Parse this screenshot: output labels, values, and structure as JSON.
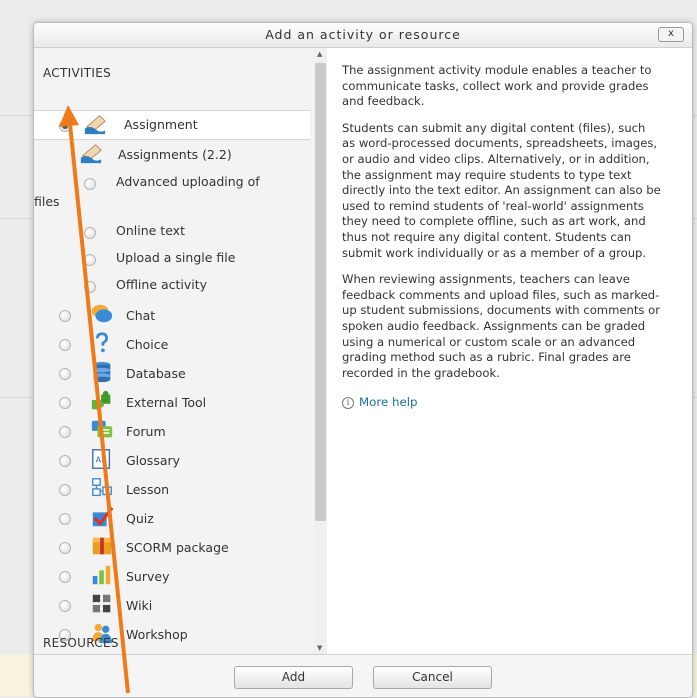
{
  "dialog": {
    "title": "Add an activity or resource",
    "close_label": "x"
  },
  "left": {
    "activities_heading": "ACTIVITIES",
    "resources_heading": "RESOURCES",
    "items": [
      {
        "label": "Assignment",
        "icon": "assignment-icon",
        "selected": true
      },
      {
        "label": "Assignments (2.2)",
        "icon": "assignment-icon"
      },
      {
        "label": "Advanced uploading of",
        "label2": "files"
      },
      {
        "label": "Online text"
      },
      {
        "label": "Upload a single file"
      },
      {
        "label": "Offline activity"
      },
      {
        "label": "Chat",
        "icon": "chat-icon"
      },
      {
        "label": "Choice",
        "icon": "question-icon"
      },
      {
        "label": "Database",
        "icon": "database-icon"
      },
      {
        "label": "External Tool",
        "icon": "puzzle-icon"
      },
      {
        "label": "Forum",
        "icon": "forum-icon"
      },
      {
        "label": "Glossary",
        "icon": "glossary-icon"
      },
      {
        "label": "Lesson",
        "icon": "lesson-icon"
      },
      {
        "label": "Quiz",
        "icon": "checkmark-icon"
      },
      {
        "label": "SCORM package",
        "icon": "package-icon"
      },
      {
        "label": "Survey",
        "icon": "bar-chart-icon"
      },
      {
        "label": "Wiki",
        "icon": "wiki-icon"
      },
      {
        "label": "Workshop",
        "icon": "people-icon"
      }
    ]
  },
  "right": {
    "para1": "The assignment activity module enables a teacher to communicate tasks, collect work and provide grades and feedback.",
    "para2": "Students can submit any digital content (files), such as word-processed documents, spreadsheets, images, or audio and video clips. Alternatively, or in addition, the assignment may require students to type text directly into the text editor. An assignment can also be used to remind students of 'real-world' assignments they need to complete offline, such as art work, and thus not require any digital content. Students can submit work individually or as a member of a group.",
    "para3": "When reviewing assignments, teachers can leave feedback comments and upload files, such as marked-up student submissions, documents with comments or spoken audio feedback. Assignments can be graded using a numerical or custom scale or an advanced grading method such as a rubric. Final grades are recorded in the gradebook.",
    "help_icon": "i",
    "help_link": "More help"
  },
  "footer": {
    "add_label": "Add",
    "cancel_label": "Cancel"
  },
  "colors": {
    "arrow": "#f07a1a",
    "link": "#1a6fa8"
  }
}
